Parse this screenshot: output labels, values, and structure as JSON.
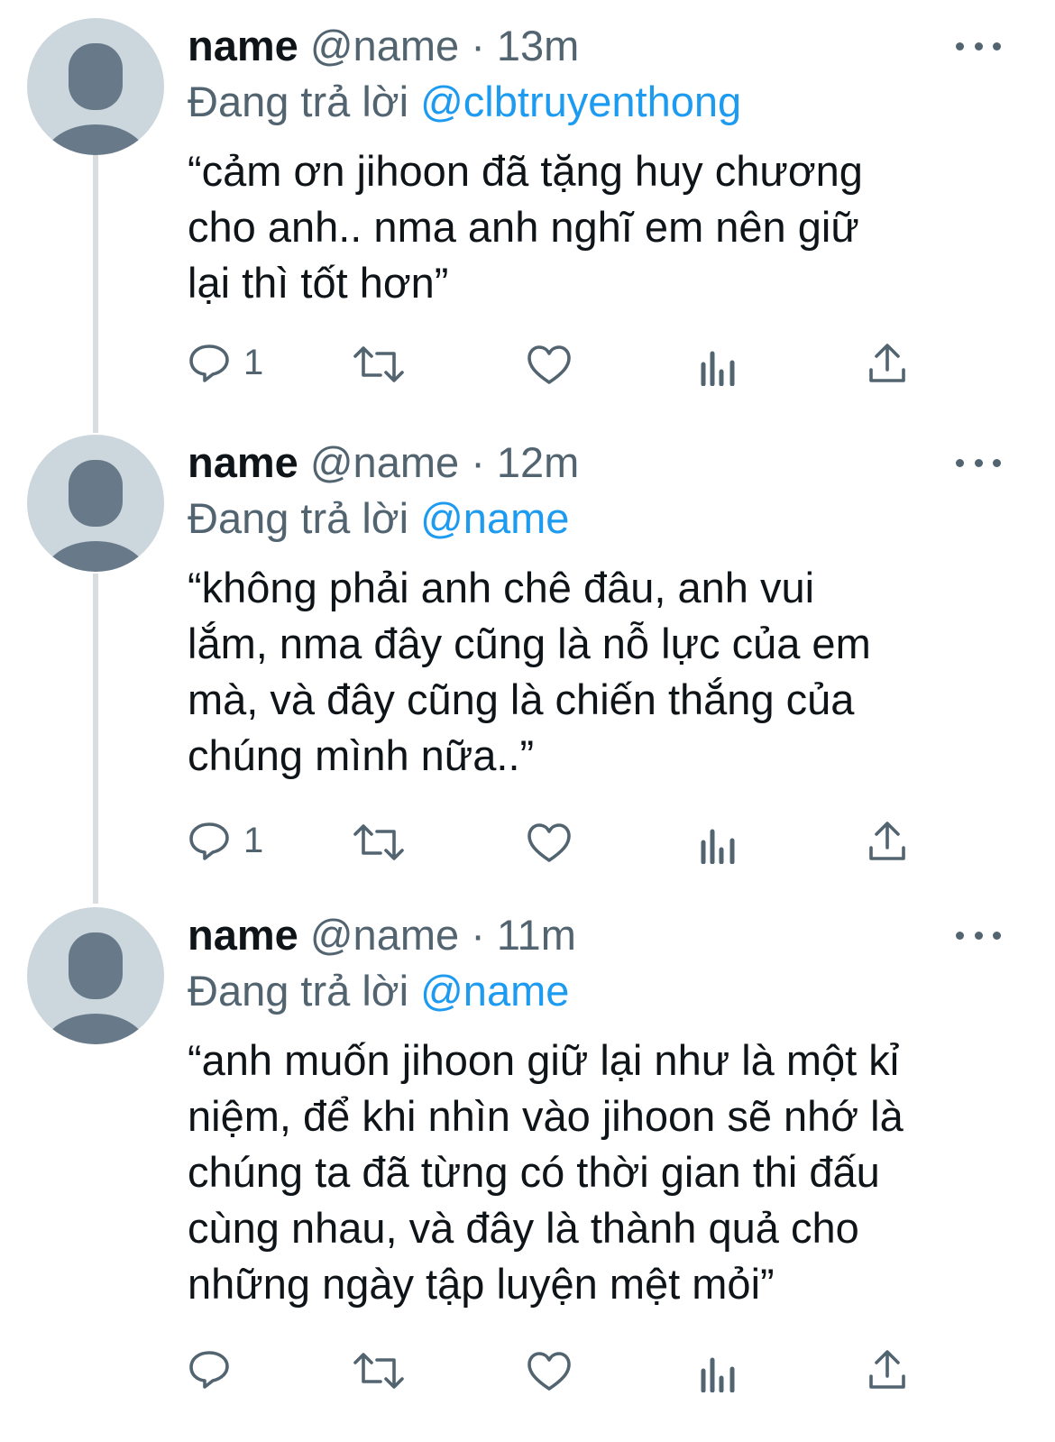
{
  "tweets": [
    {
      "display_name": "name",
      "handle": "@name",
      "separator": "·",
      "time": "13m",
      "reply_prefix": "Đang trả lời",
      "reply_to": "@clbtruyenthong",
      "text": "“cảm ơn jihoon đã tặng huy chương\ncho anh.. nma anh nghĩ em nên giữ\nlại thì tốt hơn”",
      "reply_count": "1",
      "icons": [
        "reply-icon",
        "retweet-icon",
        "like-icon",
        "analytics-icon",
        "share-icon"
      ]
    },
    {
      "display_name": "name",
      "handle": "@name",
      "separator": "·",
      "time": "12m",
      "reply_prefix": "Đang trả lời",
      "reply_to": "@name",
      "text": "“không phải anh chê đâu, anh vui\nlắm, nma đây cũng là nỗ lực của em\nmà, và đây cũng là chiến thắng của\nchúng mình nữa..”",
      "reply_count": "1",
      "icons": [
        "reply-icon",
        "retweet-icon",
        "like-icon",
        "analytics-icon",
        "share-icon"
      ]
    },
    {
      "display_name": "name",
      "handle": "@name",
      "separator": "·",
      "time": "11m",
      "reply_prefix": "Đang trả lời",
      "reply_to": "@name",
      "text": "“anh muốn jihoon giữ lại như là một kỉ\nniệm, để khi nhìn vào jihoon sẽ nhớ là\nchúng ta đã từng có thời gian thi đấu\ncùng nhau, và đây là thành quả cho\nnhững ngày tập luyện mệt mỏi”",
      "reply_count": "",
      "icons": [
        "reply-icon",
        "retweet-icon",
        "like-icon",
        "analytics-icon",
        "share-icon"
      ]
    }
  ],
  "colors": {
    "text": "#0f1419",
    "secondary": "#536471",
    "mention": "#1d9bf0",
    "avatar_bg": "#ccd6dd",
    "avatar_fg": "#687a8a",
    "thread_line": "#d9dde0"
  }
}
